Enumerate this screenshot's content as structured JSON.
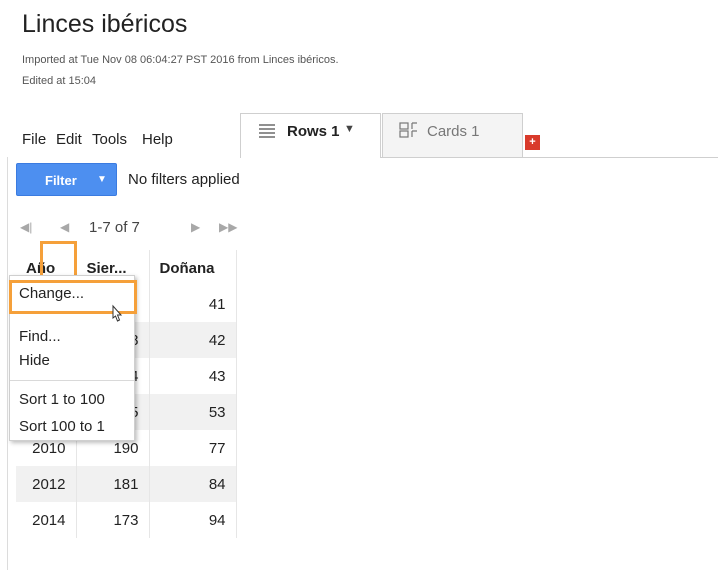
{
  "page": {
    "title": "Linces ibéricos",
    "imported": "Imported at Tue Nov 08 06:04:27 PST 2016 from Linces ibéricos.",
    "edited": "Edited at 15:04"
  },
  "menubar": {
    "file": "File",
    "edit": "Edit",
    "tools": "Tools",
    "help": "Help"
  },
  "tabs": [
    {
      "label": "Rows 1",
      "icon": "rows-icon",
      "active": true
    },
    {
      "label": "Cards 1",
      "icon": "cards-icon",
      "active": false
    }
  ],
  "add_tab_label": "+",
  "filter": {
    "button_label": "Filter",
    "status": "No filters applied"
  },
  "pager": {
    "range": "1-7 of 7"
  },
  "table": {
    "headers": [
      "Año",
      "Sier...",
      "Doñana"
    ],
    "rows": [
      [
        "",
        "",
        "41"
      ],
      [
        "",
        "8",
        "42"
      ],
      [
        "",
        "4",
        "43"
      ],
      [
        "",
        "5",
        "53"
      ],
      [
        "2010",
        "190",
        "77"
      ],
      [
        "2012",
        "181",
        "84"
      ],
      [
        "2014",
        "173",
        "94"
      ]
    ]
  },
  "column_menu": {
    "change": "Change...",
    "find": "Find...",
    "hide": "Hide",
    "sort_asc": "Sort 1 to 100",
    "sort_desc": "Sort 100 to 1"
  },
  "colors": {
    "accent": "#4d8ff0",
    "highlight": "#f5a03a",
    "add_tab": "#d93a2b"
  }
}
